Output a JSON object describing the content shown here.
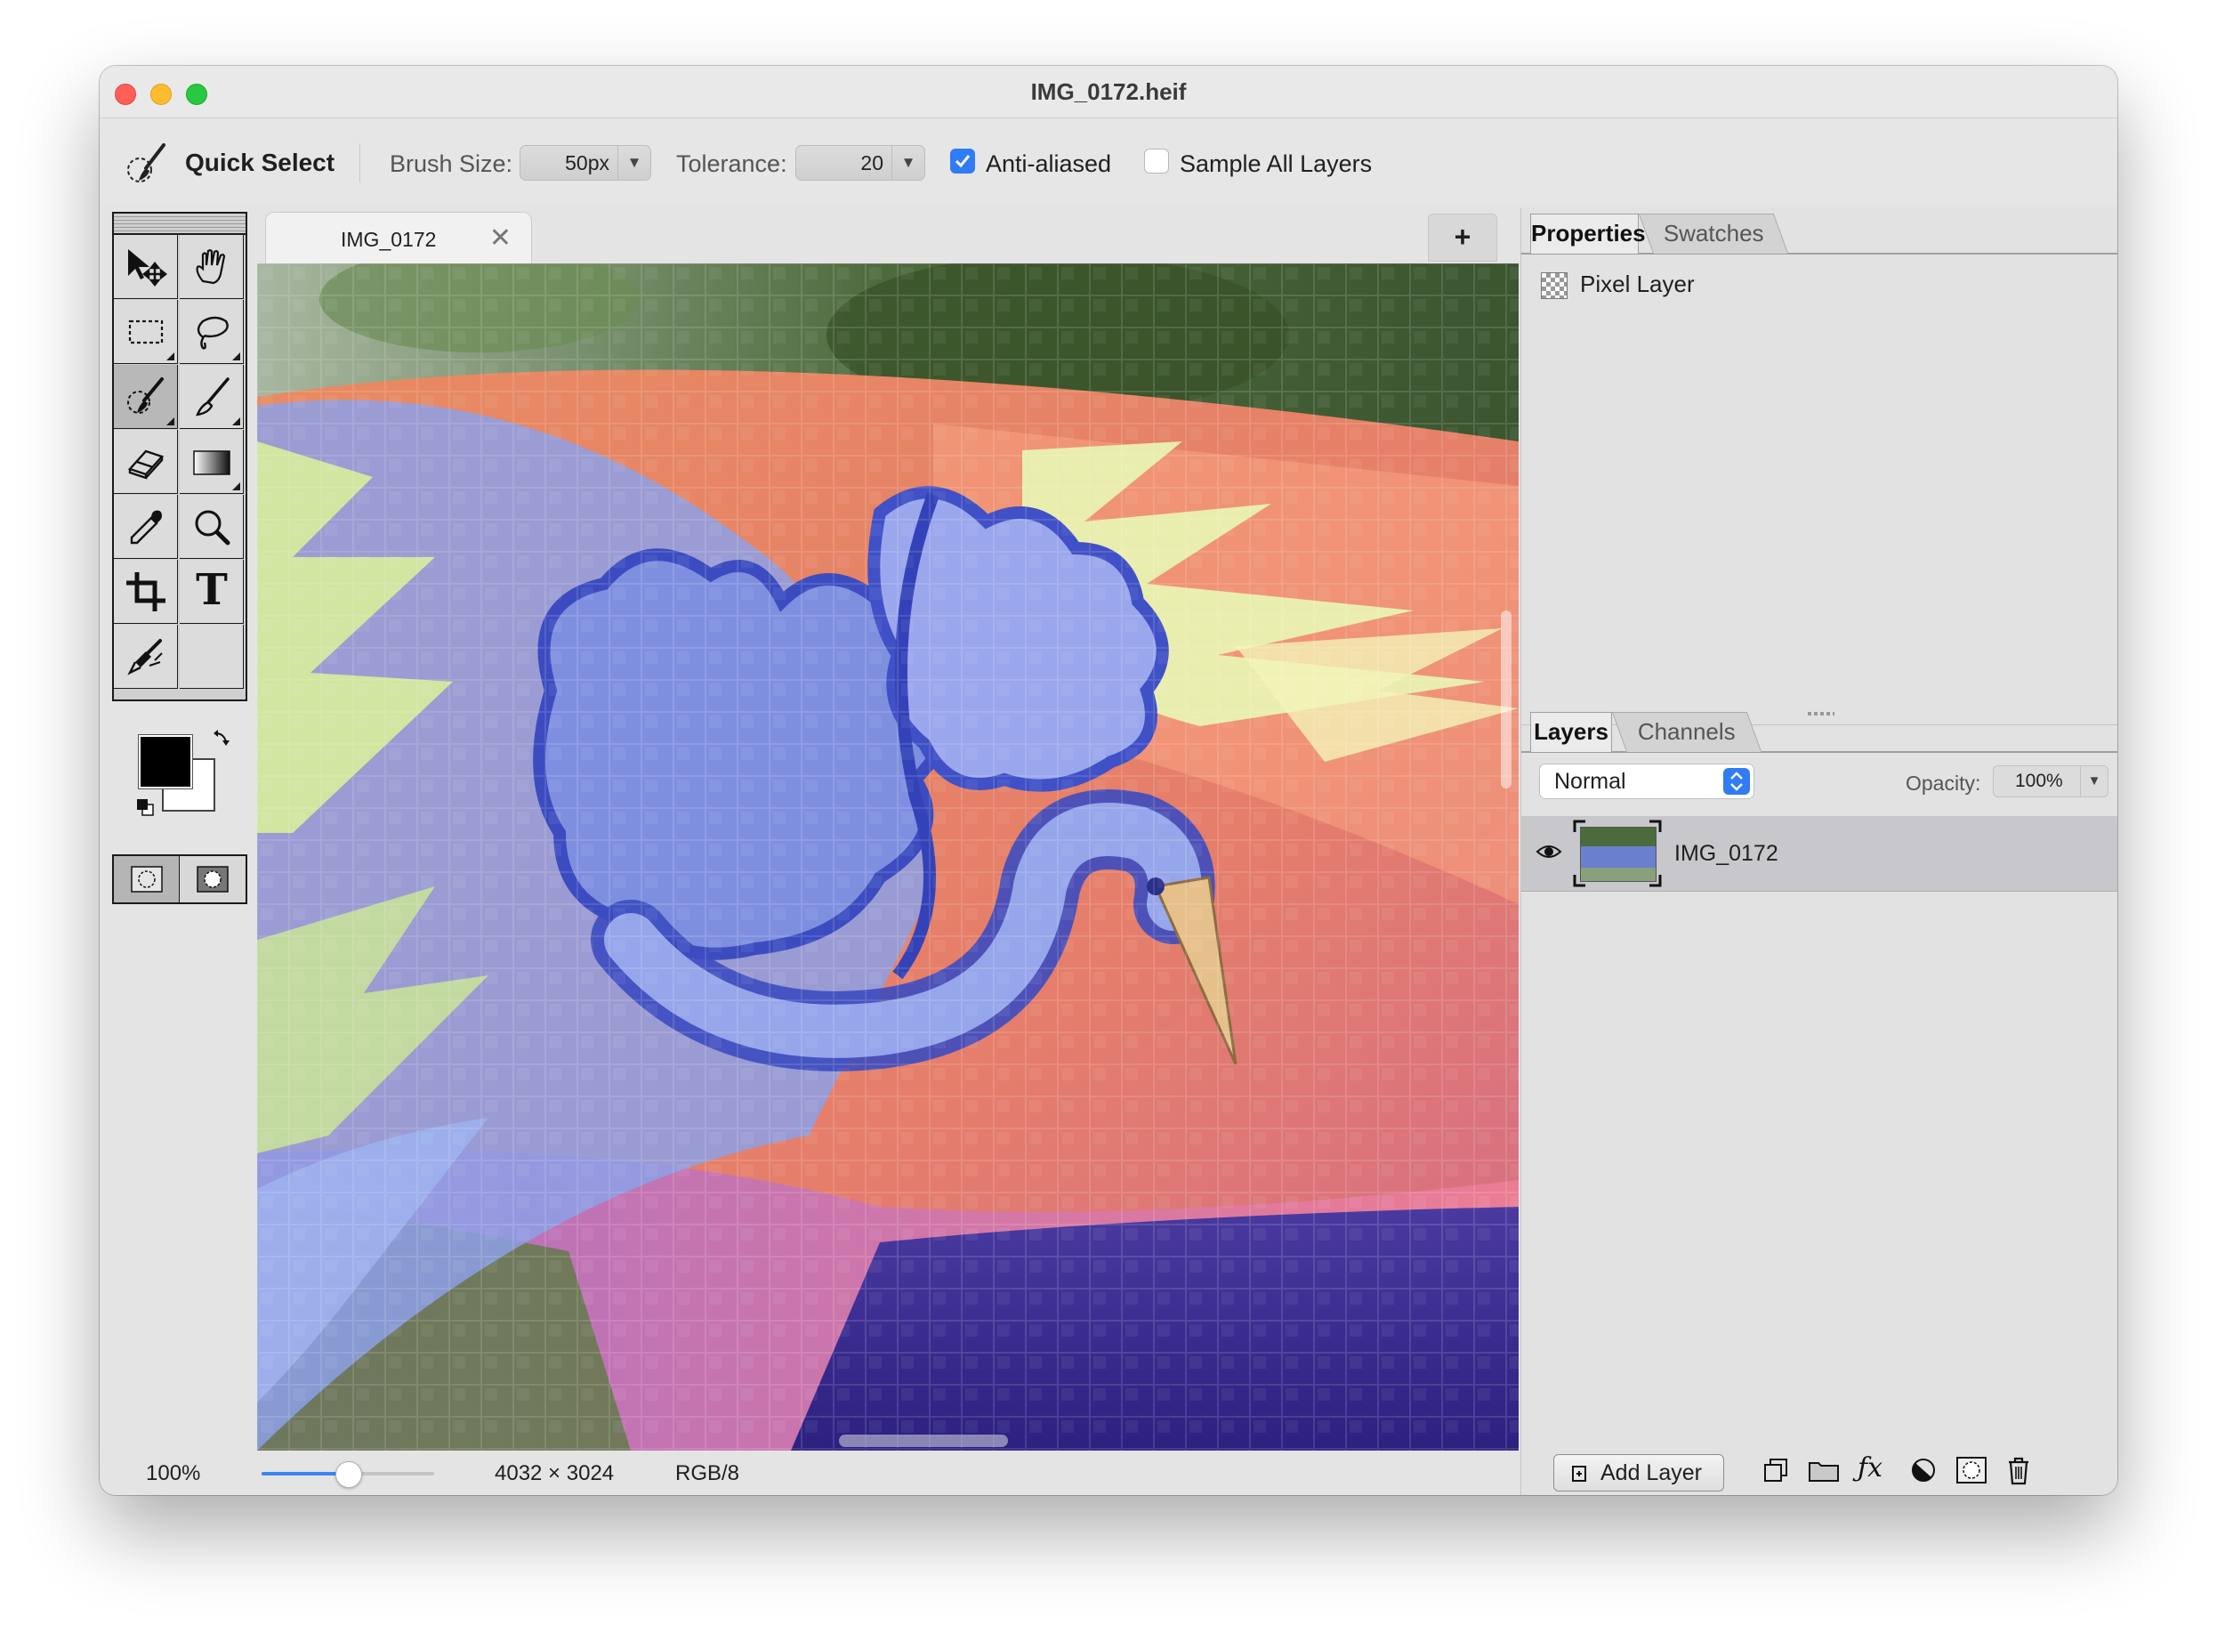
{
  "window": {
    "title": "IMG_0172.heif"
  },
  "options": {
    "tool_name": "Quick Select",
    "brush_size_label": "Brush Size:",
    "brush_size_value": "50px",
    "tolerance_label": "Tolerance:",
    "tolerance_value": "20",
    "anti_aliased": {
      "label": "Anti-aliased",
      "checked": true
    },
    "sample_all_layers": {
      "label": "Sample All Layers",
      "checked": false
    }
  },
  "document_tab": {
    "name": "IMG_0172",
    "close": "✕",
    "add": "+"
  },
  "tools": [
    {
      "icon": "move-tool-icon"
    },
    {
      "icon": "hand-tool-icon"
    },
    {
      "icon": "rectangular-marquee-icon"
    },
    {
      "icon": "lasso-icon"
    },
    {
      "icon": "quick-select-brush-icon",
      "selected": true
    },
    {
      "icon": "brush-icon"
    },
    {
      "icon": "eraser-icon"
    },
    {
      "icon": "gradient-icon"
    },
    {
      "icon": "eyedropper-icon"
    },
    {
      "icon": "zoom-icon"
    },
    {
      "icon": "crop-icon"
    },
    {
      "icon": "text-tool-icon",
      "glyph": "T"
    },
    {
      "icon": "clone-stamp-icon"
    }
  ],
  "colors": {
    "foreground": "#000000",
    "background": "#ffffff",
    "accent": "#2f7cf6"
  },
  "status": {
    "zoom": "100%",
    "zoom_slider": 0.5,
    "dimensions": "4032 × 3024",
    "mode": "RGB/8"
  },
  "properties_panel": {
    "tabs": [
      "Properties",
      "Swatches"
    ],
    "active_tab": "Properties",
    "layer_type": "Pixel Layer"
  },
  "layers_panel": {
    "tabs": [
      "Layers",
      "Channels"
    ],
    "active_tab": "Layers",
    "blend_mode": "Normal",
    "opacity_label": "Opacity:",
    "opacity_value": "100%",
    "layers": [
      {
        "name": "IMG_0172",
        "visible": true,
        "selected": true
      }
    ],
    "add_layer_label": "Add Layer",
    "footer_icons": [
      "duplicate-layer-icon",
      "folder-icon",
      "fx-icon",
      "adjustment-icon",
      "mask-icon",
      "trash-icon"
    ]
  }
}
